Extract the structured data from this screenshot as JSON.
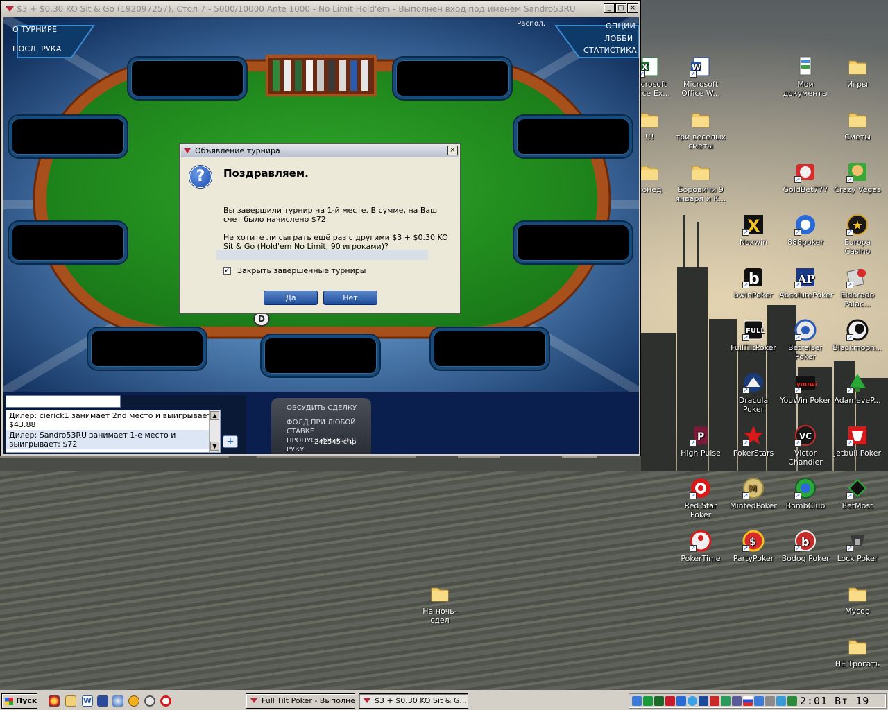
{
  "poker_window": {
    "title": "$3 + $0.30 KO Sit & Go (192097257), Стол 7 - 5000/10000 Ante 1000 - No Limit Hold'em - Выполнен вход под именем Sandro53RU",
    "nav": {
      "tournament": "О ТУРНИРЕ",
      "last_hand": "ПОСЛ. РУКА",
      "layout": "Распол.",
      "options": "ОПЦИИ",
      "lobby": "ЛОББИ",
      "stats": "СТАТИСТИКА"
    },
    "dealer_button": "D",
    "chat": {
      "input_value": "",
      "lines": [
        "Дилер: cierick1 занимает 2nd место и выигрывает: $43.88",
        "Дилер: Sandro53RU занимает 1-е место и выигрывает: $72"
      ]
    },
    "actions": {
      "discuss": "ОБСУДИТЬ СДЕЛКУ",
      "fold_any": "ФОЛД ПРИ ЛЮБОЙ СТАВКЕ",
      "skip_next": "ПРОПУСТИТЬ СЛЕД. РУКУ"
    },
    "table_id": "242545-спр"
  },
  "dialog": {
    "title": "Объявление турнира",
    "heading": "Поздравляем.",
    "message1": "Вы завершили турнир на 1-й месте. В сумме, на Ваш счет было начислено $72.",
    "message2": "Не хотите ли сыграть ещё раз с другими $3 + $0.30 KO Sit & Go (Hold'em No Limit, 90 игроками)?",
    "checkbox_label": "Закрыть завершенные турниры",
    "checkbox_checked": true,
    "yes": "Да",
    "no": "Нет"
  },
  "desktop_icons": [
    {
      "label": "Microsoft Office Ex...",
      "icon": "excel-icon"
    },
    {
      "label": "Microsoft Office W...",
      "icon": "word-icon"
    },
    {
      "label": "Мои документы",
      "icon": "my-documents-icon"
    },
    {
      "label": "Игры",
      "icon": "folder-icon"
    },
    {
      "label": "!!!",
      "icon": "folder-icon"
    },
    {
      "label": "три веселых сметы",
      "icon": "folder-icon"
    },
    {
      "label": "Сметы",
      "icon": "folder-icon"
    },
    {
      "label": "понед",
      "icon": "folder-icon"
    },
    {
      "label": "Боровичи 9 января и К...",
      "icon": "folder-icon"
    },
    {
      "label": "GoldBet777",
      "icon": "goldbet-icon"
    },
    {
      "label": "Crazy Vegas",
      "icon": "crazy-vegas-icon"
    },
    {
      "label": "Noxwin",
      "icon": "noxwin-icon"
    },
    {
      "label": "888poker",
      "icon": "888poker-icon"
    },
    {
      "label": "Europa Casino",
      "icon": "europa-casino-icon"
    },
    {
      "label": "bwinPoker",
      "icon": "bwin-icon"
    },
    {
      "label": "AbsolutePoker",
      "icon": "absolute-poker-icon"
    },
    {
      "label": "Eldorado Palac...",
      "icon": "eldorado-icon"
    },
    {
      "label": "FullTiltPoker",
      "icon": "full-tilt-icon"
    },
    {
      "label": "Betraiser Poker",
      "icon": "betraiser-icon"
    },
    {
      "label": "Blackmoon...",
      "icon": "blackmoon-icon"
    },
    {
      "label": "Dracula Poker",
      "icon": "dracula-icon"
    },
    {
      "label": "YouWin Poker",
      "icon": "youwin-icon"
    },
    {
      "label": "AdameveP...",
      "icon": "adameve-icon"
    },
    {
      "label": "High Pulse",
      "icon": "high-pulse-icon"
    },
    {
      "label": "PokerStars",
      "icon": "pokerstars-icon"
    },
    {
      "label": "Victor Chandler",
      "icon": "victor-chandler-icon"
    },
    {
      "label": "Jetbull Poker",
      "icon": "jetbull-icon"
    },
    {
      "label": "Red Star Poker",
      "icon": "red-star-icon"
    },
    {
      "label": "MintedPoker",
      "icon": "minted-icon"
    },
    {
      "label": "BombClub",
      "icon": "bombclub-icon"
    },
    {
      "label": "BetMost",
      "icon": "betmost-icon"
    },
    {
      "label": "PokerTime",
      "icon": "pokertime-icon"
    },
    {
      "label": "PartyPoker",
      "icon": "partypoker-icon"
    },
    {
      "label": "Bodog Poker",
      "icon": "bodog-icon"
    },
    {
      "label": "Lock Poker",
      "icon": "lock-poker-icon"
    },
    {
      "label": "На ночь-сдел",
      "icon": "folder-icon"
    },
    {
      "label": "Мусор",
      "icon": "folder-icon"
    },
    {
      "label": "НЕ Трогать",
      "icon": "folder-icon"
    }
  ],
  "taskbar": {
    "start": "Пуск",
    "tasks": [
      "Full Tilt Poker - Выполне...",
      "$3 + $0.30 KO Sit & G..."
    ],
    "clock_time": "2:01",
    "clock_day": "Вт 19"
  }
}
